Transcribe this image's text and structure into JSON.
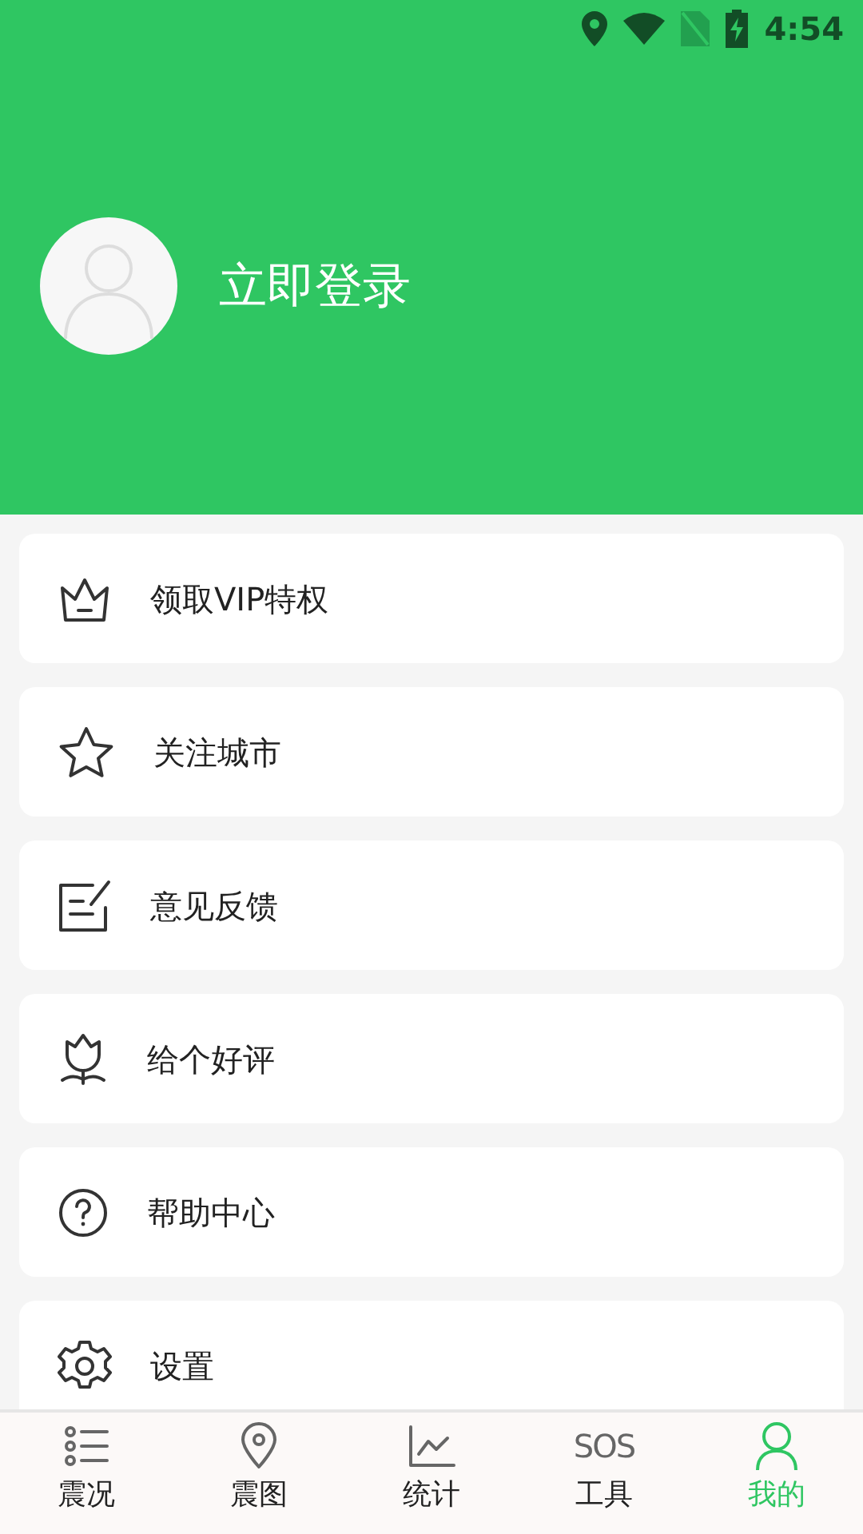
{
  "status_bar": {
    "time": "4:54"
  },
  "profile": {
    "login_label": "立即登录"
  },
  "menu": [
    {
      "label": "领取VIP特权"
    },
    {
      "label": "关注城市"
    },
    {
      "label": "意见反馈"
    },
    {
      "label": "给个好评"
    },
    {
      "label": "帮助中心"
    },
    {
      "label": "设置"
    }
  ],
  "bottom_nav": [
    {
      "label": "震况",
      "selected": false
    },
    {
      "label": "震图",
      "selected": false
    },
    {
      "label": "统计",
      "selected": false
    },
    {
      "icon_text": "SOS",
      "label": "工具",
      "selected": false
    },
    {
      "label": "我的",
      "selected": true
    }
  ]
}
